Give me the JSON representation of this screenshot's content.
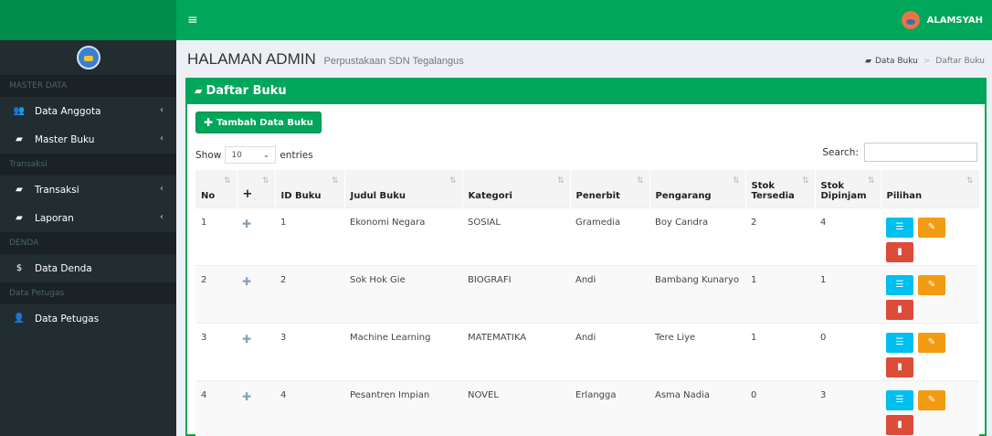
{
  "header": {
    "user_name": "ALAMSYAH",
    "menu_glyph": "≡"
  },
  "sidebar": {
    "sections": [
      {
        "header": "MASTER DATA"
      },
      {
        "header": "Transaksi"
      },
      {
        "header": "DENDA"
      },
      {
        "header": "Data Petugas"
      }
    ],
    "items": [
      {
        "label": "Data Anggota",
        "icon": "users-icon",
        "glyph": "👥",
        "chev": "‹"
      },
      {
        "label": "Master Buku",
        "icon": "book-icon",
        "glyph": "▰",
        "chev": "‹"
      },
      {
        "label": "Transaksi",
        "icon": "book-icon",
        "glyph": "▰",
        "chev": "‹"
      },
      {
        "label": "Laporan",
        "icon": "book-icon",
        "glyph": "▰",
        "chev": "‹"
      },
      {
        "label": "Data Denda",
        "icon": "dollar-icon",
        "glyph": "$"
      },
      {
        "label": "Data Petugas",
        "icon": "user-plus-icon",
        "glyph": "👤"
      }
    ]
  },
  "page": {
    "title": "HALAMAN ADMIN",
    "subtitle": "Perpustakaan SDN Tegalangus",
    "breadcrumb": [
      "Data Buku",
      "Daftar Buku"
    ]
  },
  "box": {
    "title": "Daftar Buku",
    "add_button": "Tambah Data Buku",
    "show_label": "Show",
    "entries_value": "10",
    "entries_label": "entries",
    "search_label": "Search:"
  },
  "table": {
    "columns": [
      "No",
      "+",
      "ID Buku",
      "Judul Buku",
      "Kategori",
      "Penerbit",
      "Pengarang",
      "Stok Tersedia",
      "Stok Dipinjam",
      "Pilihan"
    ],
    "rows": [
      {
        "no": "1",
        "id": "1",
        "judul": "Ekonomi Negara",
        "kategori": "SOSIAL",
        "penerbit": "Gramedia",
        "pengarang": "Boy Candra",
        "tersedia": "2",
        "dipinjam": "4"
      },
      {
        "no": "2",
        "id": "2",
        "judul": "Sok Hok Gie",
        "kategori": "BIOGRAFI",
        "penerbit": "Andi",
        "pengarang": "Bambang Kunaryo",
        "tersedia": "1",
        "dipinjam": "1"
      },
      {
        "no": "3",
        "id": "3",
        "judul": "Machine Learning",
        "kategori": "MATEMATIKA",
        "penerbit": "Andi",
        "pengarang": "Tere Liye",
        "tersedia": "1",
        "dipinjam": "0"
      },
      {
        "no": "4",
        "id": "4",
        "judul": "Pesantren Impian",
        "kategori": "NOVEL",
        "penerbit": "Erlangga",
        "pengarang": "Asma Nadia",
        "tersedia": "0",
        "dipinjam": "3"
      }
    ]
  },
  "colors": {
    "primary": "#00a65a",
    "sidebar": "#222d32",
    "info": "#00c0ef",
    "warning": "#f39c12",
    "danger": "#dd4b39"
  }
}
